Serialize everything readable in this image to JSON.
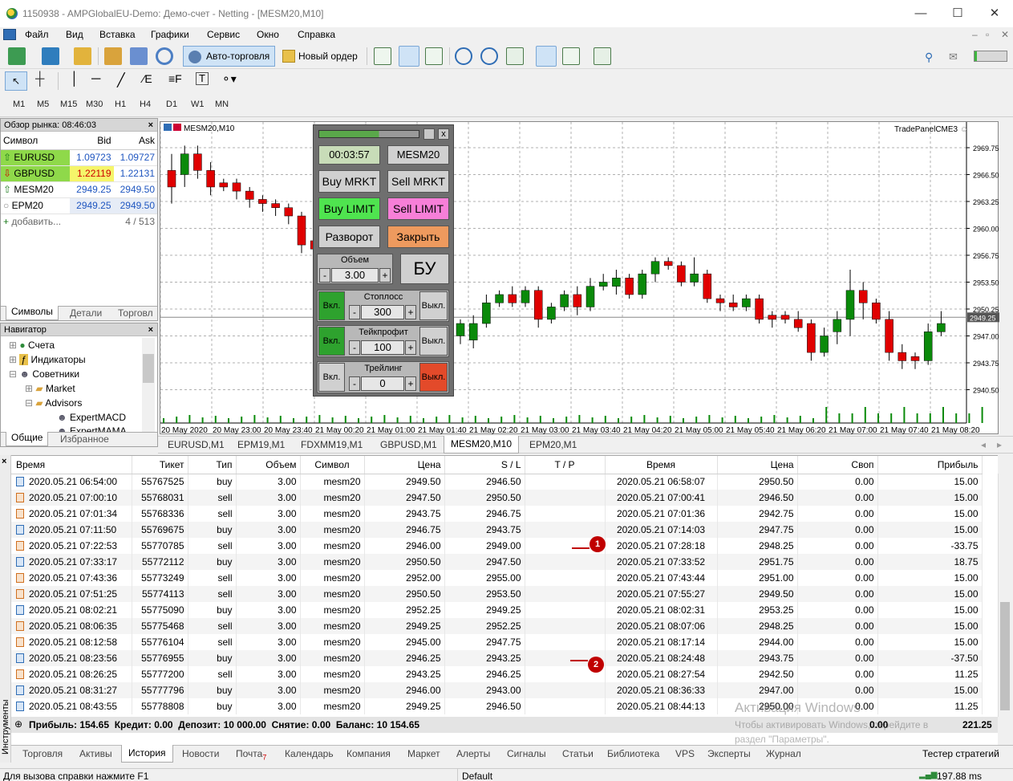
{
  "window": {
    "title": "1150938 - AMPGlobalEU-Demo: Демо-счет - Netting - [MESM20,M10]"
  },
  "menu": [
    "Файл",
    "Вид",
    "Вставка",
    "Графики",
    "Сервис",
    "Окно",
    "Справка"
  ],
  "toolbar": {
    "autotrade": "Авто-торговля",
    "new_order": "Новый ордер"
  },
  "timeframes": [
    "M1",
    "M5",
    "M15",
    "M30",
    "H1",
    "H4",
    "D1",
    "W1",
    "MN"
  ],
  "market_watch": {
    "title": "Обзор рынка: 08:46:03",
    "headers": [
      "Символ",
      "Bid",
      "Ask"
    ],
    "rows": [
      {
        "symbol": "EURUSD",
        "bid": "1.09723",
        "ask": "1.09727"
      },
      {
        "symbol": "GBPUSD",
        "bid": "1.22119",
        "ask": "1.22131"
      },
      {
        "symbol": "MESM20",
        "bid": "2949.25",
        "ask": "2949.50"
      },
      {
        "symbol": "EPM20",
        "bid": "2949.25",
        "ask": "2949.50"
      }
    ],
    "add": "добавить...",
    "count": "4 / 513",
    "tabs": [
      "Символы",
      "Детали",
      "Торговл"
    ]
  },
  "navigator": {
    "title": "Навигатор",
    "items": [
      "Счета",
      "Индикаторы",
      "Советники",
      "Market",
      "Advisors",
      "ExpertMACD",
      "ExpertMAMA"
    ],
    "tabs": [
      "Общие",
      "Избранное"
    ]
  },
  "chart": {
    "label": "MESM20,M10",
    "ea_label": "TradePanelCME3",
    "price_axis": [
      "2969.75",
      "2966.50",
      "2963.25",
      "2960.00",
      "2956.75",
      "2953.50",
      "2950.25",
      "2947.00",
      "2943.75",
      "2940.50"
    ],
    "current_price": "2949.25",
    "time_axis": [
      "20 May 2020",
      "20 May 23:00",
      "20 May 23:40",
      "21 May 00:20",
      "21 May 01:00",
      "21 May 01:40",
      "21 May 02:20",
      "21 May 03:00",
      "21 May 03:40",
      "21 May 04:20",
      "21 May 05:00",
      "21 May 05:40",
      "21 May 06:20",
      "21 May 07:00",
      "21 May 07:40",
      "21 May 08:20"
    ]
  },
  "chart_tabs": [
    "EURUSD,M1",
    "EPM19,M1",
    "FDXMM19,M1",
    "GBPUSD,M1",
    "MESM20,M10",
    "EPM20,M1"
  ],
  "panel": {
    "timer": "00:03:57",
    "symbol": "MESM20",
    "buy_market": "Buy MRKT",
    "sell_market": "Sell MRKT",
    "buy_limit": "Buy LIMIT",
    "sell_limit": "Sell LIMIT",
    "reverse": "Разворот",
    "close": "Закрыть",
    "volume_label": "Объем",
    "volume": "3.00",
    "minus": "-",
    "plus": "+",
    "be": "БУ",
    "sl_label": "Стоплосс",
    "sl": "300",
    "tp_label": "Тейкпрофит",
    "tp": "100",
    "trail_label": "Трейлинг",
    "trail": "0",
    "on": "Вкл.",
    "off": "Выкл.",
    "close_x": "x"
  },
  "history": {
    "headers": [
      "Время",
      "Тикет",
      "Тип",
      "Объем",
      "Символ",
      "Цена",
      "S / L",
      "T / P",
      "Время",
      "Цена",
      "Своп",
      "Прибыль"
    ],
    "rows": [
      [
        "2020.05.21 06:54:00",
        "55767525",
        "buy",
        "3.00",
        "mesm20",
        "2949.50",
        "2946.50",
        "",
        "2020.05.21 06:58:07",
        "2950.50",
        "0.00",
        "15.00"
      ],
      [
        "2020.05.21 07:00:10",
        "55768031",
        "sell",
        "3.00",
        "mesm20",
        "2947.50",
        "2950.50",
        "",
        "2020.05.21 07:00:41",
        "2946.50",
        "0.00",
        "15.00"
      ],
      [
        "2020.05.21 07:01:34",
        "55768336",
        "sell",
        "3.00",
        "mesm20",
        "2943.75",
        "2946.75",
        "",
        "2020.05.21 07:01:36",
        "2942.75",
        "0.00",
        "15.00"
      ],
      [
        "2020.05.21 07:11:50",
        "55769675",
        "buy",
        "3.00",
        "mesm20",
        "2946.75",
        "2943.75",
        "",
        "2020.05.21 07:14:03",
        "2947.75",
        "0.00",
        "15.00"
      ],
      [
        "2020.05.21 07:22:53",
        "55770785",
        "sell",
        "3.00",
        "mesm20",
        "2946.00",
        "2949.00",
        "",
        "2020.05.21 07:28:18",
        "2948.25",
        "0.00",
        "-33.75"
      ],
      [
        "2020.05.21 07:33:17",
        "55772112",
        "buy",
        "3.00",
        "mesm20",
        "2950.50",
        "2947.50",
        "",
        "2020.05.21 07:33:52",
        "2951.75",
        "0.00",
        "18.75"
      ],
      [
        "2020.05.21 07:43:36",
        "55773249",
        "sell",
        "3.00",
        "mesm20",
        "2952.00",
        "2955.00",
        "",
        "2020.05.21 07:43:44",
        "2951.00",
        "0.00",
        "15.00"
      ],
      [
        "2020.05.21 07:51:25",
        "55774113",
        "sell",
        "3.00",
        "mesm20",
        "2950.50",
        "2953.50",
        "",
        "2020.05.21 07:55:27",
        "2949.50",
        "0.00",
        "15.00"
      ],
      [
        "2020.05.21 08:02:21",
        "55775090",
        "buy",
        "3.00",
        "mesm20",
        "2952.25",
        "2949.25",
        "",
        "2020.05.21 08:02:31",
        "2953.25",
        "0.00",
        "15.00"
      ],
      [
        "2020.05.21 08:06:35",
        "55775468",
        "sell",
        "3.00",
        "mesm20",
        "2949.25",
        "2952.25",
        "",
        "2020.05.21 08:07:06",
        "2948.25",
        "0.00",
        "15.00"
      ],
      [
        "2020.05.21 08:12:58",
        "55776104",
        "sell",
        "3.00",
        "mesm20",
        "2945.00",
        "2947.75",
        "",
        "2020.05.21 08:17:14",
        "2944.00",
        "0.00",
        "15.00"
      ],
      [
        "2020.05.21 08:23:56",
        "55776955",
        "buy",
        "3.00",
        "mesm20",
        "2946.25",
        "2943.25",
        "",
        "2020.05.21 08:24:48",
        "2943.75",
        "0.00",
        "-37.50"
      ],
      [
        "2020.05.21 08:26:25",
        "55777200",
        "sell",
        "3.00",
        "mesm20",
        "2943.25",
        "2946.25",
        "",
        "2020.05.21 08:27:54",
        "2942.50",
        "0.00",
        "11.25"
      ],
      [
        "2020.05.21 08:31:27",
        "55777796",
        "buy",
        "3.00",
        "mesm20",
        "2946.00",
        "2943.00",
        "",
        "2020.05.21 08:36:33",
        "2947.00",
        "0.00",
        "15.00"
      ],
      [
        "2020.05.21 08:43:55",
        "55778808",
        "buy",
        "3.00",
        "mesm20",
        "2949.25",
        "2946.50",
        "",
        "2020.05.21 08:44:13",
        "2950.00",
        "0.00",
        "11.25"
      ]
    ],
    "summary": "Прибыль: 154.65  Кредит: 0.00  Депозит: 10 000.00  Снятие: 0.00  Баланс: 10 154.65",
    "summary_swap": "0.00",
    "summary_profit": "221.25",
    "markers": [
      "1",
      "2"
    ]
  },
  "watermark": {
    "line1": "Активация Windows",
    "line2": "Чтобы активировать Windows, перейдите в",
    "line3": "раздел \"Параметры\"."
  },
  "terminal_tabs": [
    "Торговля",
    "Активы",
    "История",
    "Новости",
    "Почта",
    "Календарь",
    "Компания",
    "Маркет",
    "Алерты",
    "Сигналы",
    "Статьи",
    "Библиотека",
    "VPS",
    "Эксперты",
    "Журнал"
  ],
  "mail_badge": "7",
  "strategy_tester": "Тестер стратегий",
  "side_label": "Инструменты",
  "status": {
    "help": "Для вызова справки нажмите F1",
    "profile": "Default",
    "ping": "197.88 ms"
  }
}
